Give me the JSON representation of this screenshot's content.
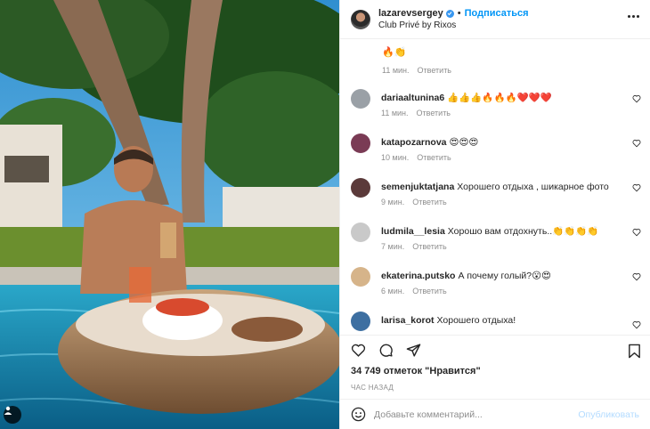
{
  "post": {
    "username": "lazarevsergey",
    "separator": "•",
    "follow_label": "Подписаться",
    "location": "Club Privé by Rixos",
    "first_comment_tail": "🔥👏",
    "first_comment_time": "11 мин.",
    "reply_label": "Ответить",
    "likes_text": "34 749 отметок \"Нравится\"",
    "posted_time": "час назад",
    "add_comment_placeholder": "Добавьте комментарий...",
    "publish_label": "Опубликовать"
  },
  "comments": [
    {
      "user": "dariaaltunina6",
      "text": "👍👍👍🔥🔥🔥❤️❤️❤️",
      "time": "11 мин.",
      "reply": "Ответить",
      "avatar_color": "#9aa0a6"
    },
    {
      "user": "katapozarnova",
      "text": "😍😍😍",
      "time": "10 мин.",
      "reply": "Ответить",
      "avatar_color": "#7a3b55"
    },
    {
      "user": "semenjuktatjana",
      "text": "Хорошего отдыха , шикарное фото",
      "time": "9 мин.",
      "reply": "Ответить",
      "avatar_color": "#5b3a3a"
    },
    {
      "user": "ludmila__lesia",
      "text": "Хорошо вам отдохнуть..👏👏👏👏",
      "time": "7 мин.",
      "reply": "Ответить",
      "avatar_color": "#c9c9c9"
    },
    {
      "user": "ekaterina.putsko",
      "text": "А почему голый?😮😍",
      "time": "6 мин.",
      "reply": "Ответить",
      "avatar_color": "#d6b48a"
    },
    {
      "user": "larisa_korot",
      "text": "Хорошего отдыха!",
      "time": "",
      "reply": "",
      "avatar_color": "#3d6fa1"
    }
  ],
  "icons": {
    "like": "heart-icon",
    "comment": "comment-icon",
    "share": "share-icon",
    "save": "bookmark-icon",
    "more": "more-icon",
    "emoji": "emoji-icon",
    "tags": "user-tag-icon"
  },
  "colors": {
    "accent": "#0095f6",
    "publish_disabled": "#b3dbff",
    "secondary_text": "#8e8e8e"
  }
}
